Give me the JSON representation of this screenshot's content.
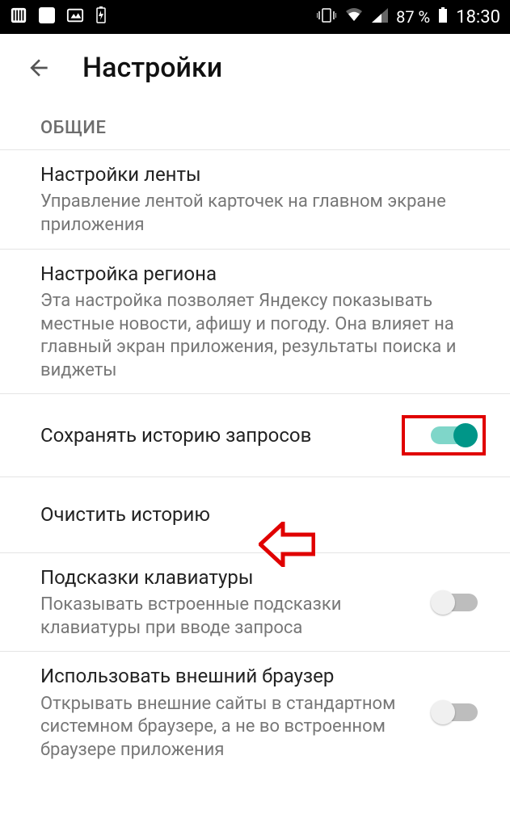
{
  "status": {
    "battery_pct": "87 %",
    "time": "18:30"
  },
  "header": {
    "title": "Настройки"
  },
  "section_general": "ОБЩИЕ",
  "settings": {
    "feed": {
      "title": "Настройки ленты",
      "desc": "Управление лентой карточек на главном экране приложения"
    },
    "region": {
      "title": "Настройка региона",
      "desc": "Эта настройка позволяет Яндексу показывать местные новости, афишу и погоду. Она влияет на главный экран приложения, результаты поиска и виджеты"
    },
    "save_history": {
      "title": "Сохранять историю запросов",
      "enabled": true
    },
    "clear_history": {
      "title": "Очистить историю"
    },
    "keyboard_hints": {
      "title": "Подсказки клавиатуры",
      "desc": "Показывать встроенные подсказки клавиатуры при вводе запроса",
      "enabled": false
    },
    "external_browser": {
      "title": "Использовать внешний браузер",
      "desc": "Открывать внешние сайты в стандартном системном браузере, а не во встроенном браузере приложения",
      "enabled": false
    }
  },
  "colors": {
    "accent": "#009688",
    "annotation": "#e00000"
  }
}
